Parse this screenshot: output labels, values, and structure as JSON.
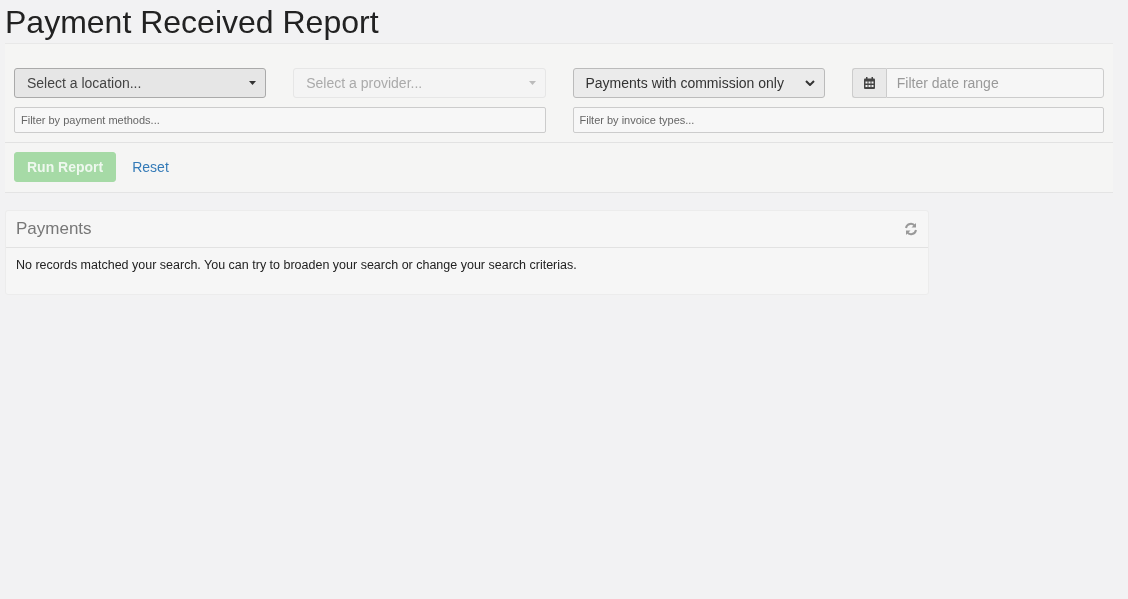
{
  "page_title": "Payment Received Report",
  "filters": {
    "selects": [
      {
        "kind": "dropdown",
        "placeholder": "Select a location...",
        "disabled": false
      },
      {
        "kind": "dropdown",
        "placeholder": "Select a provider...",
        "disabled": true
      },
      {
        "kind": "native",
        "value": "Payments with commission only",
        "disabled": false
      },
      {
        "kind": "date",
        "placeholder": "Filter date range",
        "disabled": false
      }
    ],
    "tag_fields": [
      {
        "placeholder": "Filter by payment methods..."
      },
      {
        "placeholder": "Filter by invoice types..."
      }
    ],
    "run_button": {
      "label": "Run Report",
      "disabled": true
    },
    "reset_link": {
      "label": "Reset"
    }
  },
  "payments_panel": {
    "title": "Payments",
    "message": "No records matched your search. You can try to broaden your search or change your search criterias."
  }
}
